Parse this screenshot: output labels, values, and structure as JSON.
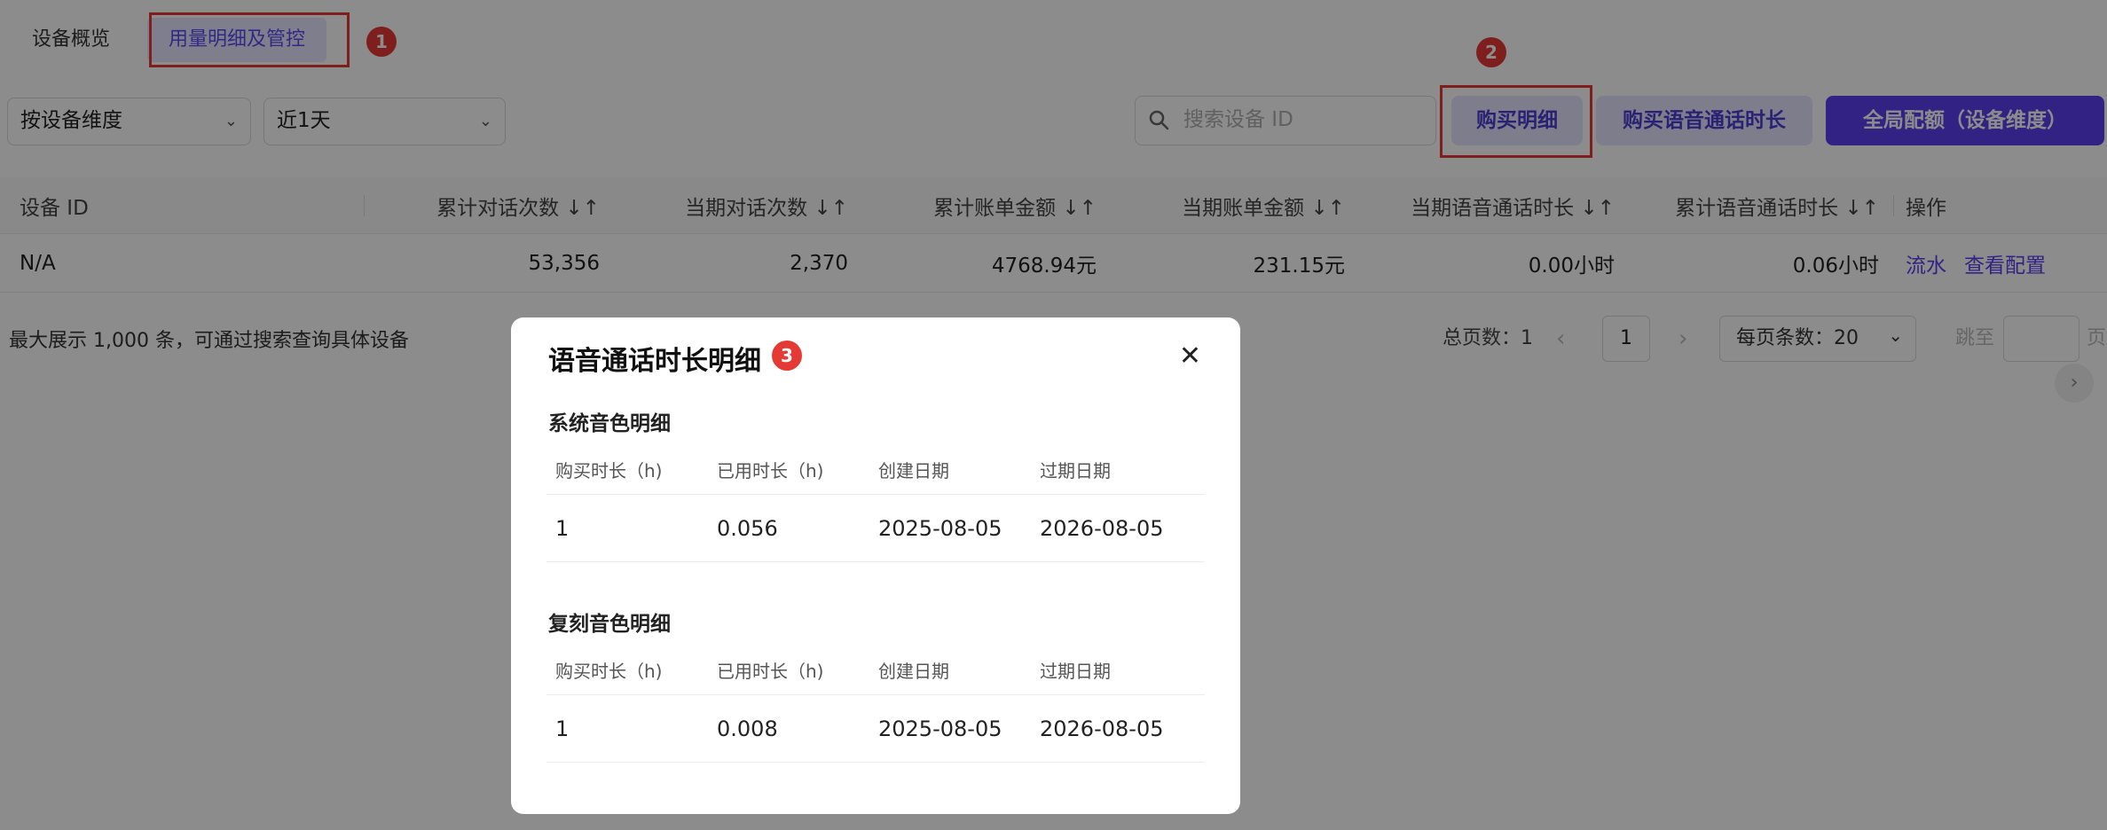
{
  "tabs": [
    {
      "label": "设备概览"
    },
    {
      "label": "用量明细及管控"
    }
  ],
  "annotations": [
    "1",
    "2",
    "3"
  ],
  "filters": {
    "dimension": "按设备维度",
    "period": "近1天",
    "search_placeholder": "搜索设备 ID"
  },
  "buttons": {
    "purchase_detail": "购买明细",
    "buy_voice": "购买语音通话时长",
    "global_quota": "全局配额（设备维度）"
  },
  "table": {
    "headers": [
      "设备 ID",
      "累计对话次数 ↓↑",
      "当期对话次数 ↓↑",
      "累计账单金额 ↓↑",
      "当期账单金额 ↓↑",
      "当期语音通话时长 ↓↑",
      "累计语音通话时长 ↓↑",
      "操作"
    ],
    "rows": [
      {
        "device_id": "N/A",
        "total_conv": "53,356",
        "period_conv": "2,370",
        "total_bill": "4768.94元",
        "period_bill": "231.15元",
        "period_voice": "0.00小时",
        "total_voice": "0.06小时",
        "action_flow": "流水",
        "action_config": "查看配置"
      }
    ]
  },
  "footer": {
    "note": "最大展示 1,000 条，可通过搜索查询具体设备",
    "total_pages": "总页数：1",
    "current_page": "1",
    "page_size": "每页条数：20",
    "goto_label": "跳至",
    "page_suffix": "页"
  },
  "modal": {
    "title": "语音通话时长明细",
    "close": "✕",
    "sections": [
      {
        "title": "系统音色明细",
        "headers": [
          "购买时长（h)",
          "已用时长（h)",
          "创建日期",
          "过期日期"
        ],
        "row": [
          "1",
          "0.056",
          "2025-08-05",
          "2026-08-05"
        ]
      },
      {
        "title": "复刻音色明细",
        "headers": [
          "购买时长（h)",
          "已用时长（h)",
          "创建日期",
          "过期日期"
        ],
        "row": [
          "1",
          "0.008",
          "2025-08-05",
          "2026-08-05"
        ]
      }
    ]
  },
  "colors": {
    "accent": "#5b3ff0",
    "annotation": "#e53935"
  }
}
